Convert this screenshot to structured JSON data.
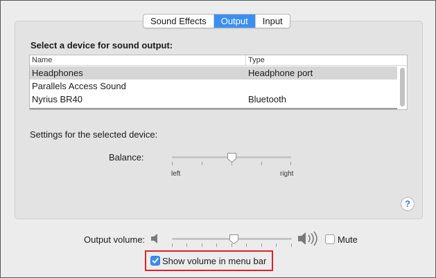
{
  "tabs": [
    {
      "label": "Sound Effects",
      "active": false
    },
    {
      "label": "Output",
      "active": true
    },
    {
      "label": "Input",
      "active": false
    }
  ],
  "device_section": {
    "title": "Select a device for sound output:",
    "columns": [
      "Name",
      "Type"
    ],
    "rows": [
      {
        "name": "Headphones",
        "type": "Headphone port",
        "selected": true
      },
      {
        "name": "Parallels Access Sound",
        "type": ""
      },
      {
        "name": "Nyrius BR40",
        "type": "Bluetooth"
      }
    ]
  },
  "settings": {
    "label": "Settings for the selected device:",
    "balance_label": "Balance:",
    "balance_left": "left",
    "balance_right": "right",
    "balance_value": 0.5
  },
  "help_glyph": "?",
  "output_volume": {
    "label": "Output volume:",
    "value": 0.52,
    "mute_label": "Mute",
    "mute_checked": false
  },
  "show_volume": {
    "label": "Show volume in menu bar",
    "checked": true
  },
  "colors": {
    "accent": "#3d8ef3",
    "highlight": "#e0202a"
  },
  "icons": {
    "volume_low": "speaker-low-icon",
    "volume_high": "speaker-high-icon",
    "help": "help-icon",
    "checkmark": "checkmark-icon"
  }
}
